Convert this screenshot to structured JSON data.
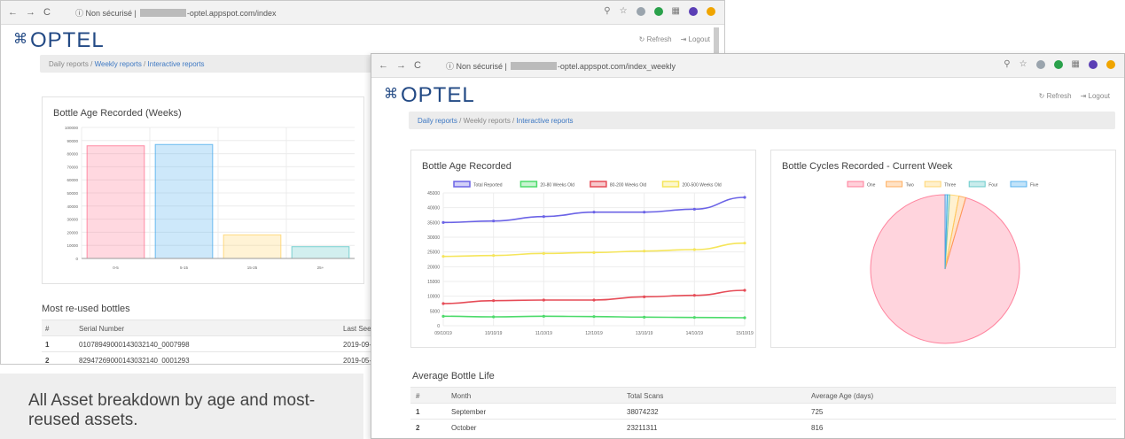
{
  "back_window": {
    "url_prefix": "Non sécurisé |",
    "url_suffix": "-optel.appspot.com/index",
    "logo": "OPTEL",
    "refresh_label": "Refresh",
    "logout_label": "Logout",
    "breadcrumb": {
      "daily": "Daily reports",
      "weekly": "Weekly reports",
      "interactive": "Interactive reports",
      "sep": "/"
    },
    "table_title": "Most re-used bottles",
    "table": {
      "headers": [
        "#",
        "Serial Number",
        "Last Seen"
      ],
      "rows": [
        [
          "1",
          "01078949000143032140_0007998",
          "2019-09-"
        ],
        [
          "2",
          "82947269000143032140_0001293",
          "2019-05-"
        ]
      ]
    }
  },
  "front_window": {
    "url_prefix": "Non sécurisé |",
    "url_suffix": "-optel.appspot.com/index_weekly",
    "logo": "OPTEL",
    "refresh_label": "Refresh",
    "logout_label": "Logout",
    "breadcrumb": {
      "daily": "Daily reports",
      "weekly": "Weekly reports",
      "interactive": "Interactive reports",
      "sep": "/"
    },
    "table_title": "Average Bottle Life",
    "table": {
      "headers": [
        "#",
        "Month",
        "Total Scans",
        "Average Age (days)"
      ],
      "rows": [
        [
          "1",
          "September",
          "38074232",
          "725"
        ],
        [
          "2",
          "October",
          "23211311",
          "816"
        ]
      ]
    }
  },
  "caption": "All Asset breakdown by age and most-reused assets.",
  "colors": {
    "accent": "#3d78c3",
    "logo": "#234a85"
  },
  "chart_data": [
    {
      "type": "bar",
      "title": "Bottle Age Recorded (Weeks)",
      "categories": [
        "0-5",
        "5-15",
        "15-25",
        "25+"
      ],
      "values": [
        86000,
        87000,
        18000,
        9000
      ],
      "colors": [
        "#ff6384",
        "#36a2eb",
        "#ffce56",
        "#4bc0c0"
      ],
      "ylim": [
        0,
        100000
      ],
      "yticks": [
        0,
        10000,
        20000,
        30000,
        40000,
        50000,
        60000,
        70000,
        80000,
        90000,
        100000
      ],
      "grid": true
    },
    {
      "type": "line",
      "title": "Bottle Age Recorded",
      "x": [
        "09/10/19",
        "10/10/19",
        "11/10/19",
        "12/10/19",
        "13/10/19",
        "14/10/19",
        "15/10/19"
      ],
      "series": [
        {
          "name": "Total Reported",
          "color": "#6b63e6",
          "values": [
            35000,
            35500,
            37000,
            38500,
            38500,
            39500,
            43500
          ]
        },
        {
          "name": "20-80 Weeks Old",
          "color": "#4ddb6b",
          "values": [
            3200,
            3000,
            3200,
            3100,
            2900,
            2800,
            2700
          ]
        },
        {
          "name": "80-200 Weeks Old",
          "color": "#e64c57",
          "values": [
            7500,
            8500,
            8700,
            8700,
            9800,
            10300,
            12000
          ]
        },
        {
          "name": "200-500 Weeks Old",
          "color": "#f5e55a",
          "values": [
            23500,
            23800,
            24500,
            24800,
            25300,
            25800,
            28000
          ]
        }
      ],
      "ylim": [
        0,
        45000
      ],
      "yticks": [
        0,
        5000,
        10000,
        15000,
        20000,
        25000,
        30000,
        35000,
        40000,
        45000
      ],
      "legend": "top",
      "grid": true
    },
    {
      "type": "pie",
      "title": "Bottle Cycles Recorded - Current Week",
      "slices": [
        {
          "label": "One",
          "value": 95.5,
          "color": "#ff6384"
        },
        {
          "label": "Two",
          "value": 1.5,
          "color": "#ff9f40"
        },
        {
          "label": "Three",
          "value": 2.0,
          "color": "#ffce56"
        },
        {
          "label": "Four",
          "value": 0.5,
          "color": "#4bc0c0"
        },
        {
          "label": "Five",
          "value": 0.5,
          "color": "#36a2eb"
        }
      ],
      "legend": "top"
    }
  ]
}
